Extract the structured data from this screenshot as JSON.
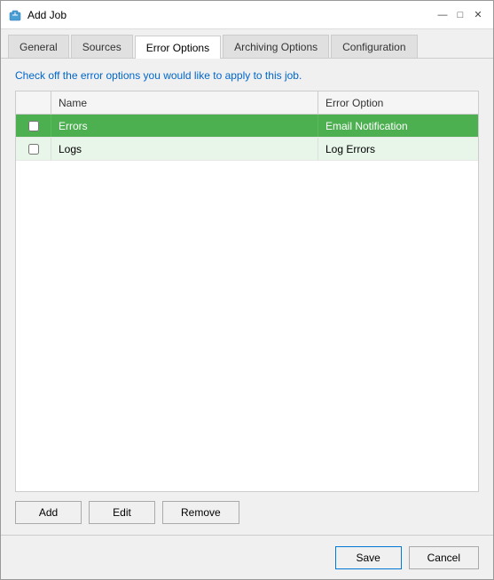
{
  "window": {
    "title": "Add Job",
    "icon": "briefcase-icon"
  },
  "titleButtons": {
    "minimize": "—",
    "maximize": "□",
    "close": "✕"
  },
  "tabs": [
    {
      "id": "general",
      "label": "General",
      "active": false
    },
    {
      "id": "sources",
      "label": "Sources",
      "active": false
    },
    {
      "id": "error-options",
      "label": "Error Options",
      "active": true
    },
    {
      "id": "archiving-options",
      "label": "Archiving Options",
      "active": false
    },
    {
      "id": "configuration",
      "label": "Configuration",
      "active": false
    }
  ],
  "instruction": "Check off the error options you would like to apply to this job.",
  "table": {
    "columns": {
      "name": "Name",
      "errorOption": "Error Option"
    },
    "rows": [
      {
        "id": 1,
        "name": "Errors",
        "errorOption": "Email Notification",
        "checked": false,
        "selected": true,
        "alt": false
      },
      {
        "id": 2,
        "name": "Logs",
        "errorOption": "Log Errors",
        "checked": false,
        "selected": false,
        "alt": true
      }
    ]
  },
  "buttons": {
    "add": "Add",
    "edit": "Edit",
    "remove": "Remove"
  },
  "footer": {
    "save": "Save",
    "cancel": "Cancel"
  }
}
